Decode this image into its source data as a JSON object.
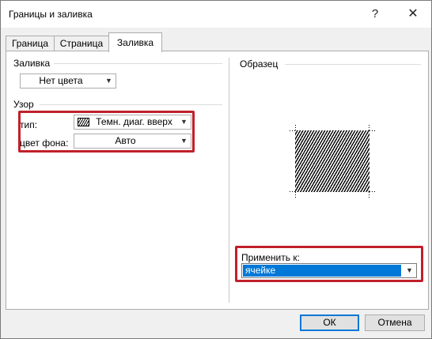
{
  "window": {
    "title": "Границы и заливка",
    "help": "?",
    "close": "✕"
  },
  "tabs": [
    {
      "label": "Граница",
      "active": false
    },
    {
      "label": "Страница",
      "active": false
    },
    {
      "label": "Заливка",
      "active": true
    }
  ],
  "fill": {
    "group_label": "Заливка",
    "color_value": "Нет цвета"
  },
  "pattern": {
    "group_label": "Узор",
    "type_label": "тип:",
    "type_value": "Темн. диаг. вверх",
    "bgcolor_label": "цвет фона:",
    "bgcolor_value": "Авто"
  },
  "preview": {
    "label": "Образец"
  },
  "apply": {
    "label": "Применить к:",
    "value": "ячейке"
  },
  "buttons": {
    "ok": "ОК",
    "cancel": "Отмена"
  },
  "colors": {
    "highlight": "#c0202a",
    "selection": "#0078d7"
  }
}
